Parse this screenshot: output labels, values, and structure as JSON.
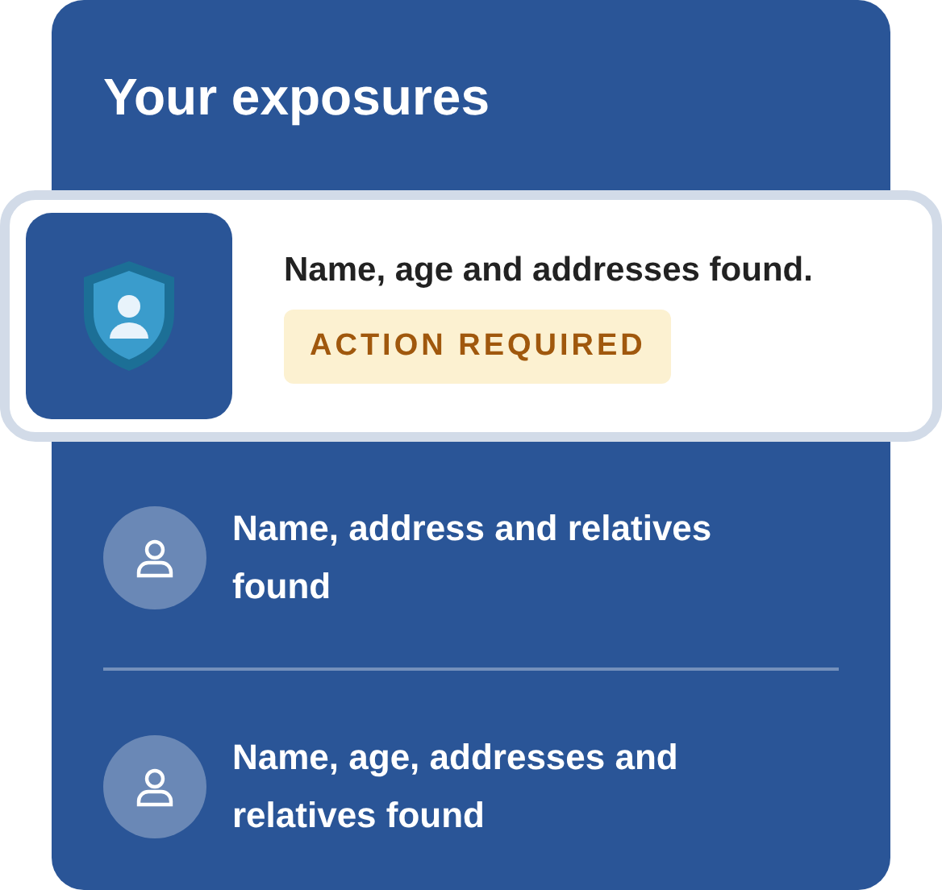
{
  "title": "Your exposures",
  "featured": {
    "text": "Name, age and addresses found.",
    "badge": "ACTION REQUIRED"
  },
  "exposures": [
    {
      "text": "Name, address and relatives found"
    },
    {
      "text": "Name, age, addresses and relatives found"
    }
  ]
}
